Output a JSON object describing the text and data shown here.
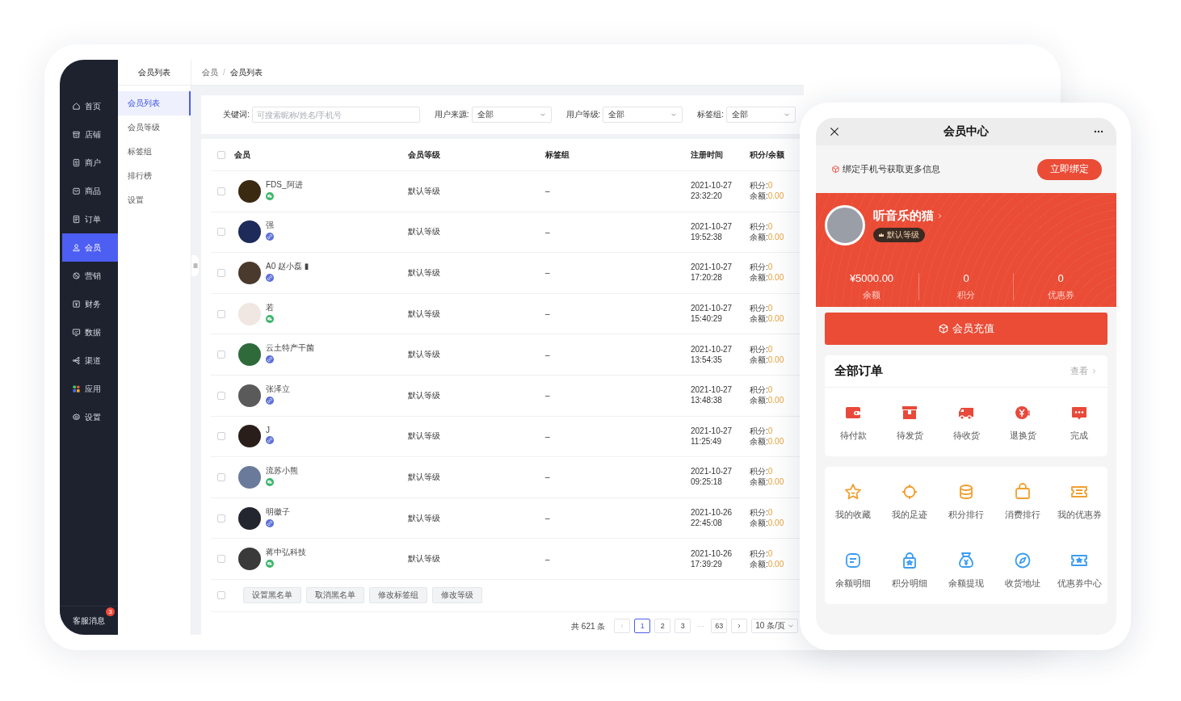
{
  "sidebar": {
    "nav": [
      {
        "label": "首页",
        "selected": false
      },
      {
        "label": "店铺",
        "selected": false
      },
      {
        "label": "商户",
        "selected": false
      },
      {
        "label": "商品",
        "selected": false
      },
      {
        "label": "订单",
        "selected": false
      },
      {
        "label": "会员",
        "selected": true
      },
      {
        "label": "营销",
        "selected": false
      },
      {
        "label": "财务",
        "selected": false
      },
      {
        "label": "数据",
        "selected": false
      },
      {
        "label": "渠道",
        "selected": false
      },
      {
        "label": "应用",
        "selected": false
      },
      {
        "label": "设置",
        "selected": false
      }
    ],
    "support": {
      "label": "客服消息",
      "badge": "3"
    }
  },
  "subnav": {
    "title": "会员列表",
    "items": [
      {
        "label": "会员列表",
        "selected": true
      },
      {
        "label": "会员等级",
        "selected": false
      },
      {
        "label": "标签组",
        "selected": false
      },
      {
        "label": "排行榜",
        "selected": false
      },
      {
        "label": "设置",
        "selected": false
      }
    ]
  },
  "breadcrumb": {
    "items": [
      "会员",
      "会员列表"
    ],
    "separator": "/"
  },
  "filters": {
    "keyword": {
      "label": "关键词:",
      "placeholder": "可搜索昵称/姓名/手机号"
    },
    "selects": [
      {
        "label": "用户来源:",
        "value": "全部"
      },
      {
        "label": "用户等级:",
        "value": "全部"
      },
      {
        "label": "标签组:",
        "value": "全部"
      }
    ]
  },
  "table": {
    "all_selected": false,
    "columns": [
      "会员",
      "会员等级",
      "标签组",
      "注册时间",
      "积分/余额"
    ],
    "rows": [
      {
        "selected": false,
        "name": "FDS_阿进",
        "source": {
          "kind": "wechat"
        },
        "level": "默认等级",
        "tags": "–",
        "date": "2021-10-27",
        "time": "23:32:20",
        "points_label": "积分:",
        "points": "0",
        "balance_label": "余额:",
        "balance": "0.00"
      },
      {
        "selected": false,
        "name": "强",
        "source": {
          "kind": "link"
        },
        "level": "默认等级",
        "tags": "–",
        "date": "2021-10-27",
        "time": "19:52:38",
        "points_label": "积分:",
        "points": "0",
        "balance_label": "余额:",
        "balance": "0.00"
      },
      {
        "selected": false,
        "name": "A0 赵小磊 ▮",
        "source": {
          "kind": "link"
        },
        "level": "默认等级",
        "tags": "–",
        "date": "2021-10-27",
        "time": "17:20:28",
        "points_label": "积分:",
        "points": "0",
        "balance_label": "余额:",
        "balance": "0.00"
      },
      {
        "selected": false,
        "name": "若",
        "source": {
          "kind": "wechat"
        },
        "level": "默认等级",
        "tags": "–",
        "date": "2021-10-27",
        "time": "15:40:29",
        "points_label": "积分:",
        "points": "0",
        "balance_label": "余额:",
        "balance": "0.00"
      },
      {
        "selected": false,
        "name": "云土特产干菌",
        "source": {
          "kind": "link"
        },
        "level": "默认等级",
        "tags": "–",
        "date": "2021-10-27",
        "time": "13:54:35",
        "points_label": "积分:",
        "points": "0",
        "balance_label": "余额:",
        "balance": "0.00"
      },
      {
        "selected": false,
        "name": "张泽立",
        "source": {
          "kind": "link"
        },
        "level": "默认等级",
        "tags": "–",
        "date": "2021-10-27",
        "time": "13:48:38",
        "points_label": "积分:",
        "points": "0",
        "balance_label": "余额:",
        "balance": "0.00"
      },
      {
        "selected": false,
        "name": "J",
        "source": {
          "kind": "link"
        },
        "level": "默认等级",
        "tags": "–",
        "date": "2021-10-27",
        "time": "11:25:49",
        "points_label": "积分:",
        "points": "0",
        "balance_label": "余额:",
        "balance": "0.00"
      },
      {
        "selected": false,
        "name": "流苏小熊",
        "source": {
          "kind": "wechat"
        },
        "level": "默认等级",
        "tags": "–",
        "date": "2021-10-27",
        "time": "09:25:18",
        "points_label": "积分:",
        "points": "0",
        "balance_label": "余额:",
        "balance": "0.00"
      },
      {
        "selected": false,
        "name": "明徽子",
        "source": {
          "kind": "link"
        },
        "level": "默认等级",
        "tags": "–",
        "date": "2021-10-26",
        "time": "22:45:08",
        "points_label": "积分:",
        "points": "0",
        "balance_label": "余额:",
        "balance": "0.00"
      },
      {
        "selected": false,
        "name": "蒋中弘科技",
        "source": {
          "kind": "wechat"
        },
        "level": "默认等级",
        "tags": "–",
        "date": "2021-10-26",
        "time": "17:39:29",
        "points_label": "积分:",
        "points": "0",
        "balance_label": "余额:",
        "balance": "0.00"
      }
    ]
  },
  "bulk_actions": {
    "selected": false,
    "buttons": [
      "设置黑名单",
      "取消黑名单",
      "修改标签组",
      "修改等级"
    ]
  },
  "pagination": {
    "total": "共 621 条",
    "pages": [
      {
        "kind": "page",
        "label": "1",
        "selected": true
      },
      {
        "kind": "page",
        "label": "2",
        "selected": false
      },
      {
        "kind": "page",
        "label": "3",
        "selected": false
      },
      {
        "kind": "ellipsis",
        "label": "···",
        "selected": false
      },
      {
        "kind": "page",
        "label": "63",
        "selected": false
      }
    ],
    "page_size": "10 条/页"
  },
  "phone": {
    "title": "会员中心",
    "bind": {
      "text": "绑定手机号获取更多信息",
      "button": "立即绑定"
    },
    "profile": {
      "name": "听音乐的猫",
      "level": "默认等级"
    },
    "stats": [
      {
        "value": "¥5000.00",
        "label": "余额"
      },
      {
        "value": "0",
        "label": "积分"
      },
      {
        "value": "0",
        "label": "优惠券"
      }
    ],
    "recharge": "会员充值",
    "orders": {
      "title": "全部订单",
      "more": "查看",
      "items": [
        "待付款",
        "待发货",
        "待收货",
        "退换货",
        "完成"
      ]
    },
    "services": [
      [
        "我的收藏",
        "我的足迹",
        "积分排行",
        "消费排行",
        "我的优惠券"
      ],
      [
        "余额明细",
        "积分明细",
        "余额提现",
        "收货地址",
        "优惠券中心"
      ]
    ]
  }
}
